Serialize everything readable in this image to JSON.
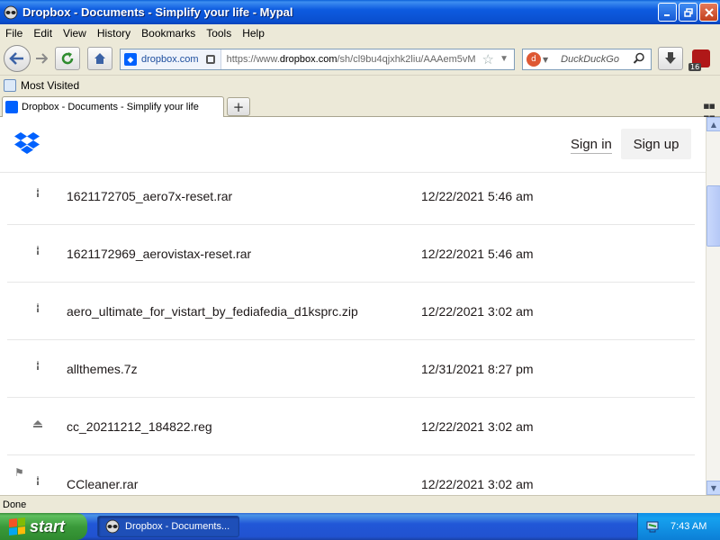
{
  "window": {
    "title": "Dropbox - Documents - Simplify your life - Mypal",
    "app_icon": "mypal-raccoon-icon"
  },
  "menubar": {
    "items": [
      "File",
      "Edit",
      "View",
      "History",
      "Bookmarks",
      "Tools",
      "Help"
    ]
  },
  "navbar": {
    "identity_label": "dropbox.com",
    "url_prefix": "https://www.",
    "url_domain": "dropbox.com",
    "url_rest": "/sh/cl9bu4qjxhk2liu/AAAem5vM",
    "search_placeholder": "DuckDuckGo",
    "addon_badge": "16"
  },
  "bookmarks": {
    "most_visited": "Most Visited"
  },
  "tabs": [
    {
      "label": "Dropbox - Documents - Simplify your life"
    }
  ],
  "page": {
    "header": {
      "sign_in": "Sign in",
      "sign_up": "Sign up"
    },
    "files": [
      {
        "name": "1621172705_aero7x-reset.rar",
        "date": "12/22/2021 5:46 am",
        "icon": "archive-icon"
      },
      {
        "name": "1621172969_aerovistax-reset.rar",
        "date": "12/22/2021 5:46 am",
        "icon": "archive-icon"
      },
      {
        "name": "aero_ultimate_for_vistart_by_fediafedia_d1ksprc.zip",
        "date": "12/22/2021 3:02 am",
        "icon": "archive-icon"
      },
      {
        "name": "allthemes.7z",
        "date": "12/31/2021 8:27 pm",
        "icon": "archive-icon"
      },
      {
        "name": "cc_20211212_184822.reg",
        "date": "12/22/2021 3:02 am",
        "icon": "eject-icon"
      },
      {
        "name": "CCleaner.rar",
        "date": "12/22/2021 3:02 am",
        "icon": "archive-icon"
      }
    ]
  },
  "statusbar": {
    "text": "Done"
  },
  "taskbar": {
    "start_label": "start",
    "task_label": "Dropbox - Documents...",
    "clock": "7:43 AM"
  },
  "colors": {
    "dropbox_blue": "#0061fe",
    "xp_blue": "#0a4fcf",
    "start_green": "#3a9a3a"
  }
}
